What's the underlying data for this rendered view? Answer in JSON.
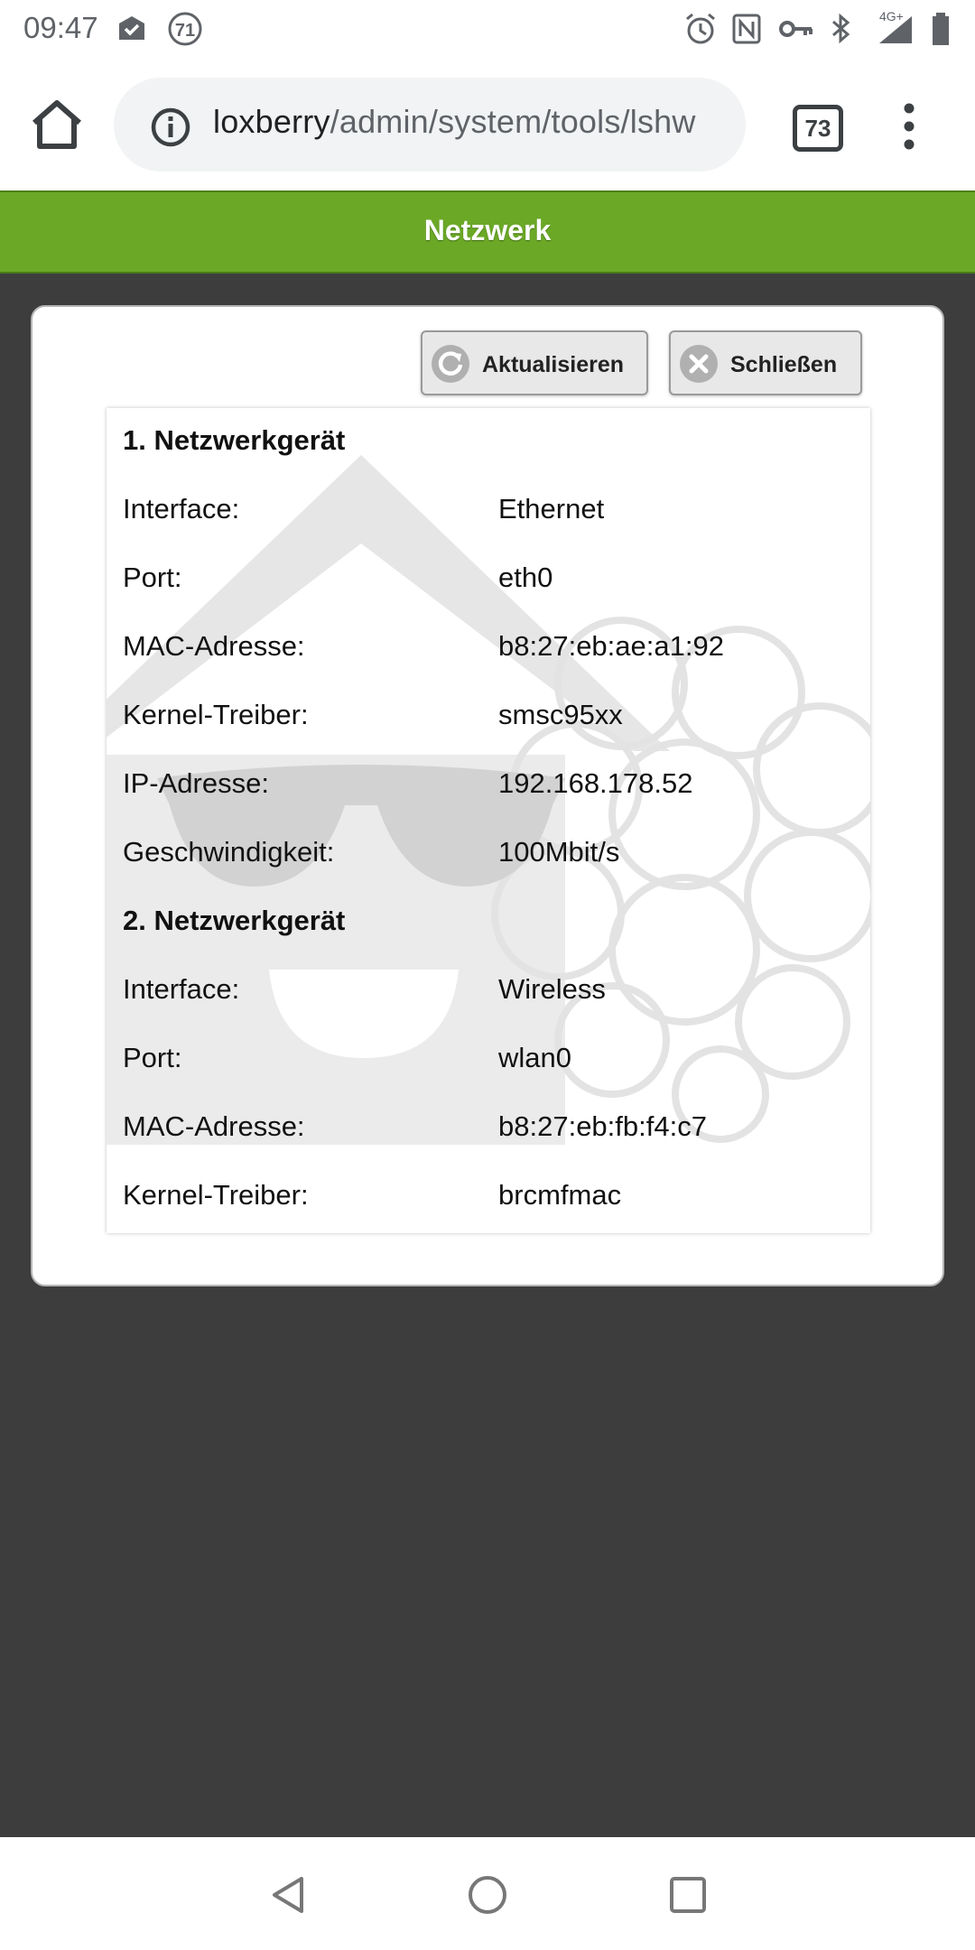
{
  "status_bar": {
    "time": "09:47",
    "notification_badge": "71",
    "network_label": "4G+",
    "icons": [
      "check-icon",
      "badge-icon",
      "alarm-icon",
      "nfc-icon",
      "vpn-key-icon",
      "bluetooth-icon",
      "signal-icon",
      "battery-icon"
    ]
  },
  "browser": {
    "url_host": "loxberry",
    "url_path": "/admin/system/tools/lshw",
    "tab_count": "73"
  },
  "header": {
    "title": "Netzwerk",
    "color": "#6ba826"
  },
  "dialog": {
    "refresh_label": "Aktualisieren",
    "close_label": "Schließen",
    "devices": [
      {
        "title": "1. Netzwerkgerät",
        "fields": [
          {
            "key": "Interface:",
            "value": "Ethernet"
          },
          {
            "key": "Port:",
            "value": "eth0"
          },
          {
            "key": "MAC-Adresse:",
            "value": "b8:27:eb:ae:a1:92"
          },
          {
            "key": "Kernel-Treiber:",
            "value": "smsc95xx"
          },
          {
            "key": "IP-Adresse:",
            "value": "192.168.178.52"
          },
          {
            "key": "Geschwindigkeit:",
            "value": "100Mbit/s"
          }
        ]
      },
      {
        "title": "2. Netzwerkgerät",
        "fields": [
          {
            "key": "Interface:",
            "value": "Wireless"
          },
          {
            "key": "Port:",
            "value": "wlan0"
          },
          {
            "key": "MAC-Adresse:",
            "value": "b8:27:eb:fb:f4:c7"
          },
          {
            "key": "Kernel-Treiber:",
            "value": "brcmfmac"
          }
        ]
      }
    ]
  },
  "nav": {
    "icons": [
      "back-icon",
      "home-circle-icon",
      "recents-icon"
    ]
  }
}
